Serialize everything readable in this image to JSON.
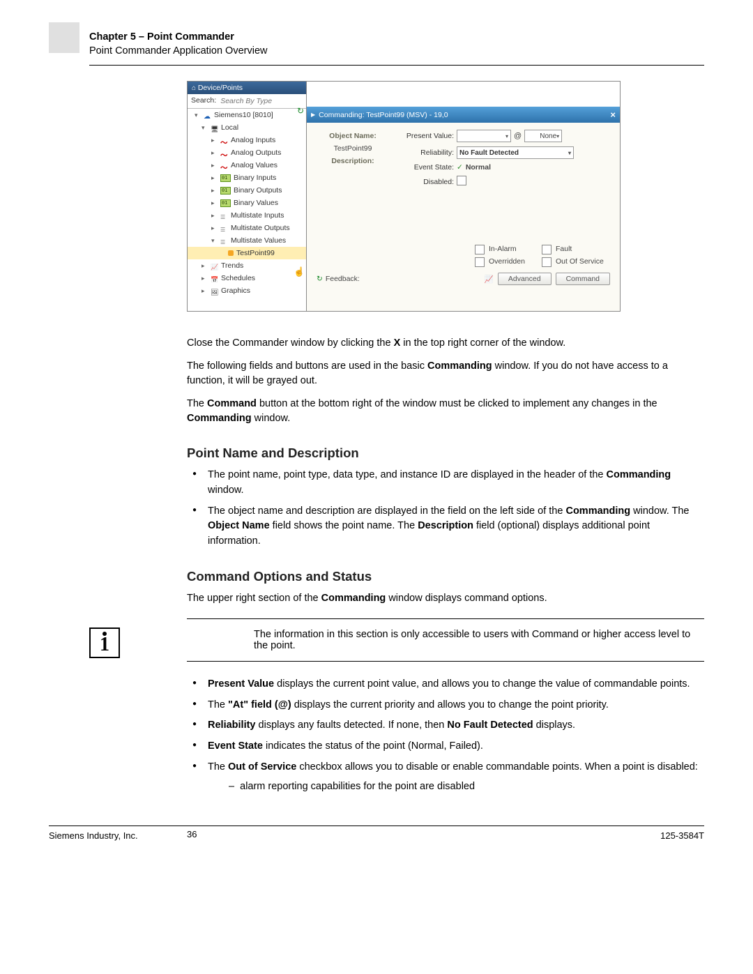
{
  "header": {
    "chapter": "Chapter 5 – Point Commander",
    "subtitle": "Point Commander Application Overview"
  },
  "screenshot": {
    "panel_title": "Device/Points",
    "search_label": "Search:",
    "search_placeholder": "Search By Type",
    "root": "Siemens10 [8010]",
    "local": "Local",
    "nodes": {
      "analog_inputs": "Analog Inputs",
      "analog_outputs": "Analog Outputs",
      "analog_values": "Analog Values",
      "binary_inputs": "Binary Inputs",
      "binary_outputs": "Binary Outputs",
      "binary_values": "Binary Values",
      "multistate_inputs": "Multistate Inputs",
      "multistate_outputs": "Multistate Outputs",
      "multistate_values": "Multistate Values",
      "testpoint": "TestPoint99",
      "trends": "Trends",
      "schedules": "Schedules",
      "graphics": "Graphics"
    },
    "cmd_title": "Commanding: TestPoint99 (MSV) - 19,0",
    "labels": {
      "object_name": "Object Name:",
      "object_name_val": "TestPoint99",
      "description": "Description:",
      "present_value": "Present Value:",
      "reliability": "Reliability:",
      "reliability_val": "No Fault Detected",
      "event_state": "Event State:",
      "event_state_val": "Normal",
      "disabled": "Disabled:",
      "none": "None",
      "in_alarm": "In-Alarm",
      "fault": "Fault",
      "overridden": "Overridden",
      "out_of_service": "Out Of Service",
      "feedback": "Feedback:",
      "advanced": "Advanced",
      "command": "Command"
    }
  },
  "body": {
    "p1a": "Close the Commander window by clicking the ",
    "p1b": " in the top right corner of the window.",
    "x": "X",
    "p2a": "The following fields and buttons are used in the basic ",
    "p2b": " window. If you do not have access to a function, it will be grayed out.",
    "commanding": "Commanding",
    "p3a": "The ",
    "p3b": " button at the bottom right of the window must be clicked to implement any changes in the ",
    "p3c": " window.",
    "command": "Command",
    "h_point": "Point Name and Description",
    "pt1a": "The point name, point type, data type, and instance ID are displayed in the header of the ",
    "pt1b": " window.",
    "pt2a": "The object name and description are displayed in the field on the left side of the ",
    "pt2b": " window. The ",
    "pt2c": " field shows the point name. The ",
    "pt2d": " field (optional) displays additional point information.",
    "object_name": "Object Name",
    "description": "Description",
    "h_cmd": "Command Options and Status",
    "p_cmd_intro_a": "The upper right section of the ",
    "p_cmd_intro_b": " window displays command options.",
    "info": "The information in this section is only accessible to users with Command or higher access level to the point.",
    "li_pv_b": "Present Value",
    "li_pv": " displays the current point value, and allows you to change the value of commandable points.",
    "li_at_a": "The ",
    "li_at_b": "\"At\" field (@)",
    "li_at_c": " displays the current priority and allows you to change the point priority.",
    "li_rel_b": "Reliability",
    "li_rel_c": " displays any faults detected. If none, then ",
    "li_rel_nfd": "No Fault Detected",
    "li_rel_d": " displays.",
    "li_es_b": "Event State",
    "li_es_c": " indicates the status of the point (Normal, Failed).",
    "li_oos_a": "The ",
    "li_oos_b": "Out of Service",
    "li_oos_c": " checkbox allows you to disable or enable commandable points. When a point is disabled:",
    "li_oos_sub": "alarm reporting capabilities for the point are disabled"
  },
  "footer": {
    "page": "36",
    "left": "Siemens Industry, Inc.",
    "right": "125-3584T"
  }
}
